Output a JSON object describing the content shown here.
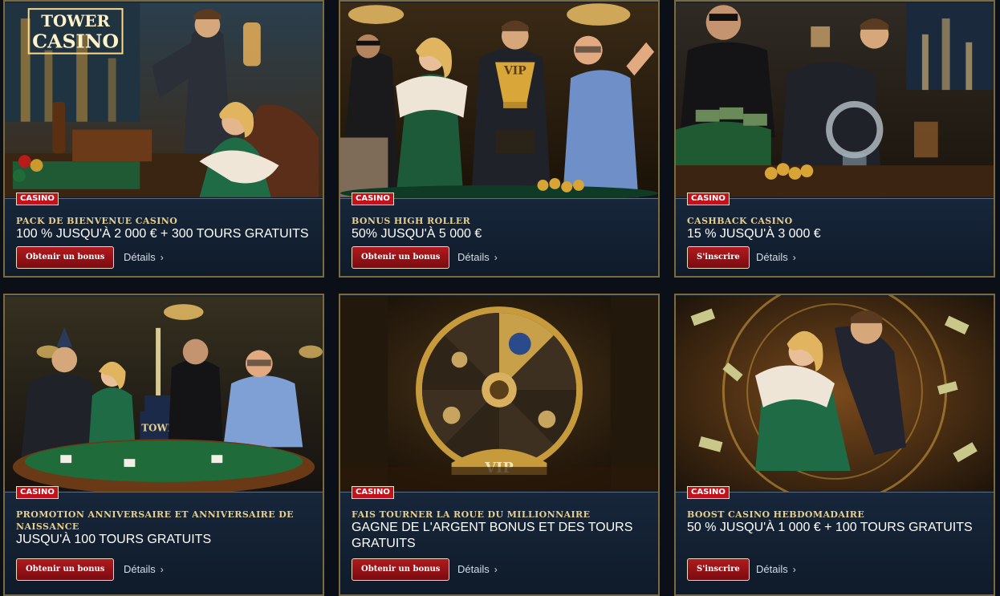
{
  "cards": [
    {
      "badge": "CASINO",
      "title": "Pack de bienvenue casino",
      "offer": "100 % jusqu'à 2 000 € + 300 tours gratuits",
      "cta": "Obtenir un bonus",
      "details": "Détails",
      "sign": "TOWER CASINO"
    },
    {
      "badge": "CASINO",
      "title": "Bonus High Roller",
      "offer": "50% jusqu'à 5 000 €",
      "cta": "Obtenir un bonus",
      "details": "Détails",
      "trophy": "VIP"
    },
    {
      "badge": "CASINO",
      "title": "Cashback casino",
      "offer": "15 % jusqu'à 3 000 €",
      "cta": "S'inscrire",
      "details": "Détails"
    },
    {
      "badge": "CASINO",
      "title": "Promotion anniversaire et anniversaire de naissance",
      "offer": "Jusqu'à 100 tours gratuits",
      "cta": "Obtenir un bonus",
      "details": "Détails",
      "cake": "TOWER"
    },
    {
      "badge": "CASINO",
      "title": "Fais tourner la roue du millionnaire",
      "offer": "Gagne de l'argent bonus et des tours gratuits",
      "cta": "Obtenir un bonus",
      "details": "Détails",
      "wheel": "VIP"
    },
    {
      "badge": "CASINO",
      "title": "Boost casino hebdomadaire",
      "offer": "50 % jusqu'à 1 000 € + 100 tours gratuits",
      "cta": "S'inscrire",
      "details": "Détails"
    }
  ],
  "colors": {
    "accent_gold": "#e6cf93",
    "badge_red": "#c3121c",
    "card_bg": "#121d2c",
    "button_red": "#9b1418"
  },
  "icons": {
    "details": "chevron-right-icon"
  }
}
